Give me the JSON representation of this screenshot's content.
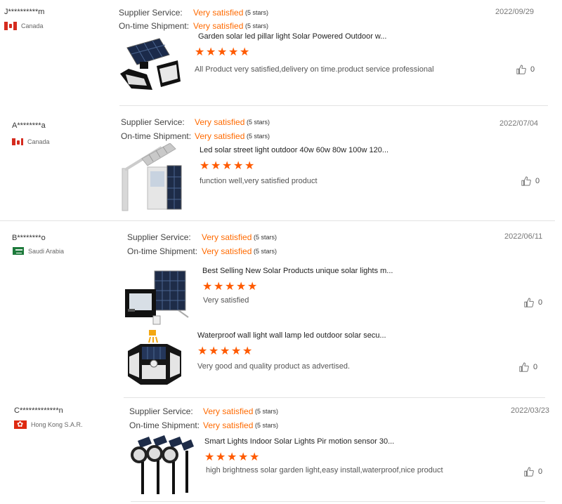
{
  "labels": {
    "supplier_service": "Supplier Service:",
    "on_time_shipment": "On-time Shipment:"
  },
  "reviews": [
    {
      "buyer": "J**********m",
      "country": "Canada",
      "flag": "canada-flag",
      "supplier_service": "Very satisfied",
      "supplier_stars": "(5 stars)",
      "shipment": "Very satisfied",
      "shipment_stars": "(5 stars)",
      "date": "2022/09/29",
      "products": [
        {
          "title": "Garden solar led pillar light Solar Powered Outdoor w...",
          "stars": 5,
          "comment": "All Product very satisfied,delivery on time.product service professional",
          "likes": "0",
          "image": "solar-wall-light-image"
        }
      ]
    },
    {
      "buyer": "A********a",
      "country": "Canada",
      "flag": "canada-flag",
      "supplier_service": "Very satisfied",
      "supplier_stars": "(5 stars)",
      "shipment": "Very satisfied",
      "shipment_stars": "(5 stars)",
      "date": "2022/07/04",
      "products": [
        {
          "title": "Led solar street light outdoor 40w 60w 80w 100w 120...",
          "stars": 5,
          "comment": "function well,very satisfied product",
          "likes": "0",
          "image": "solar-street-light-image"
        }
      ]
    },
    {
      "buyer": "B********o",
      "country": "Saudi Arabia",
      "flag": "saudi-arabia-flag",
      "supplier_service": "Very satisfied",
      "supplier_stars": "(5 stars)",
      "shipment": "Very satisfied",
      "shipment_stars": "(5 stars)",
      "date": "2022/06/11",
      "products": [
        {
          "title": "Best Selling New Solar Products unique solar lights m...",
          "stars": 5,
          "comment": "Very satisfied",
          "likes": "0",
          "image": "solar-flood-light-image"
        },
        {
          "title": "Waterproof wall light wall lamp led outdoor solar secu...",
          "stars": 5,
          "comment": "Very good and quality product as advertised.",
          "likes": "0",
          "image": "solar-security-wall-lamp-image"
        }
      ]
    },
    {
      "buyer": "C*************n",
      "country": "Hong Kong S.A.R.",
      "flag": "hong-kong-flag",
      "supplier_service": "Very satisfied",
      "supplier_stars": "(5 stars)",
      "shipment": "Very satisfied",
      "shipment_stars": "(5 stars)",
      "date": "2022/03/23",
      "products": [
        {
          "title": "Smart Lights Indoor Solar Lights Pir motion sensor 30...",
          "stars": 5,
          "comment": "high brightness solar garden light,easy install,waterproof,nice product",
          "likes": "0",
          "image": "solar-spotlights-image"
        }
      ]
    }
  ],
  "colors": {
    "accent": "#ff6a00",
    "star": "#ff5a00",
    "divider": "#e3e3e3"
  }
}
